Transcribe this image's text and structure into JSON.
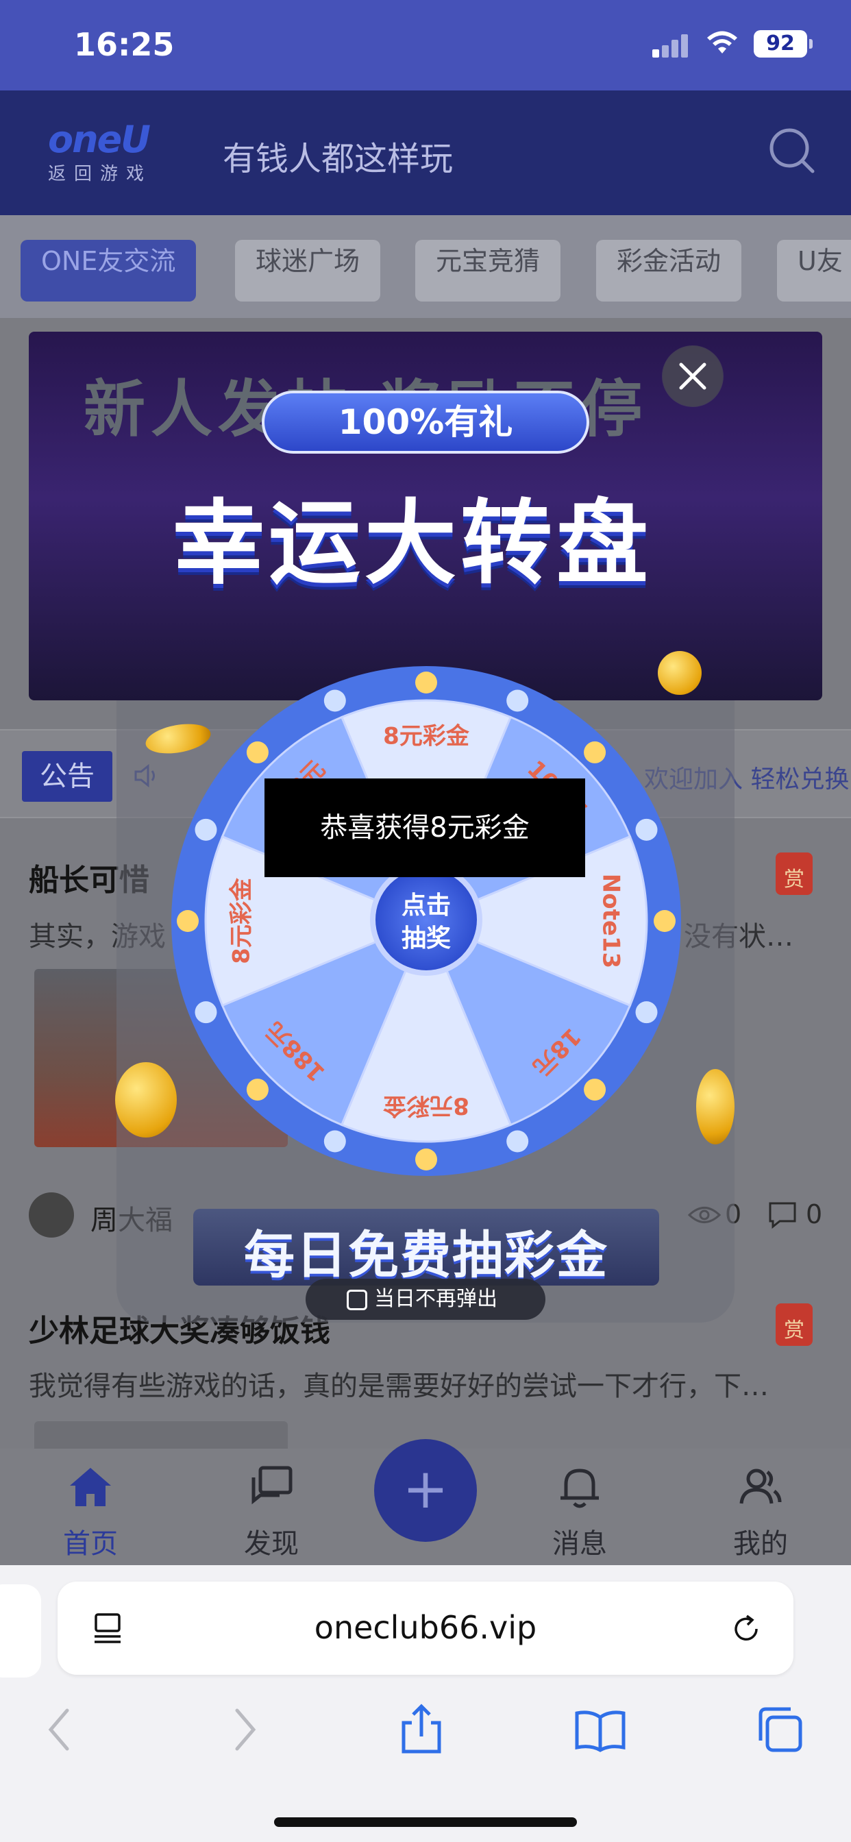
{
  "status_bar": {
    "time": "16:25",
    "battery": "92"
  },
  "header": {
    "logo": "oneU",
    "logo_sub": "返回游戏",
    "title": "有钱人都这样玩"
  },
  "tabs": [
    {
      "label": "ONE友交流",
      "active": true
    },
    {
      "label": "球迷广场",
      "active": false
    },
    {
      "label": "元宝竞猜",
      "active": false
    },
    {
      "label": "彩金活动",
      "active": false
    },
    {
      "label": "U友",
      "active": false
    }
  ],
  "banner": {
    "ghost_text": "新人发帖 奖励不停"
  },
  "notice": {
    "tag": "公告",
    "text": "欢迎加入 轻松兑换"
  },
  "posts": [
    {
      "title": "船长可惜",
      "excerpt_left": "其实，游戏",
      "excerpt_right": "没有状…",
      "reward": "赏",
      "author": "周大福",
      "views": "0",
      "comments": "0"
    },
    {
      "title": "少林足球大奖凑够饭钱",
      "excerpt": "我觉得有些游戏的话，真的是需要好好的尝试一下才行，下…",
      "reward": "赏"
    }
  ],
  "bottom_nav": [
    {
      "label": "首页",
      "icon": "home-icon",
      "active": true
    },
    {
      "label": "发现",
      "icon": "chat-icon",
      "active": false
    },
    {
      "label": "消息",
      "icon": "bell-icon",
      "active": false
    },
    {
      "label": "我的",
      "icon": "user-icon",
      "active": false
    }
  ],
  "browser": {
    "url": "oneclub66.vip"
  },
  "modal": {
    "pill": "100%有礼",
    "title": "幸运大转盘",
    "wheel_segments": [
      "8元彩金",
      "100元",
      "Note13",
      "18元",
      "8元彩金",
      "188元",
      "8元彩金",
      "188元"
    ],
    "toast": "恭喜获得8元彩金",
    "spin_button": "点击抽奖",
    "daily": "每日免费抽彩金",
    "no_show": "当日不再弹出"
  },
  "colors": {
    "brand": "#232b70",
    "accent": "#3f4da8",
    "wheel_outer": "#4a74e6"
  }
}
